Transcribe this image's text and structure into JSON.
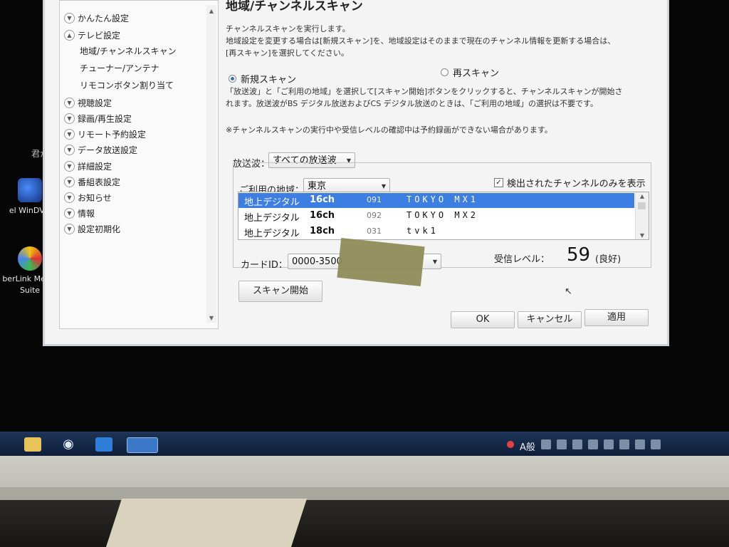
{
  "desktop": {
    "side_text": "君か",
    "icons": [
      {
        "label": "el WinDVD"
      },
      {
        "label": "berLink Media Suite"
      }
    ]
  },
  "sidebar": {
    "items": [
      {
        "label": "かんたん設定"
      },
      {
        "label": "テレビ設定"
      },
      {
        "label": "地域/チャンネルスキャン"
      },
      {
        "label": "チューナー/アンテナ"
      },
      {
        "label": "リモコンボタン割り当て"
      },
      {
        "label": "視聴設定"
      },
      {
        "label": "録画/再生設定"
      },
      {
        "label": "リモート予約設定"
      },
      {
        "label": "データ放送設定"
      },
      {
        "label": "詳細設定"
      },
      {
        "label": "番組表設定"
      },
      {
        "label": "お知らせ"
      },
      {
        "label": "情報"
      },
      {
        "label": "設定初期化"
      }
    ]
  },
  "main": {
    "title": "地域/チャンネルスキャン",
    "desc1": [
      "チャンネルスキャンを実行します。",
      "地域設定を変更する場合は[新規スキャン]を、地域設定はそのままで現在のチャンネル情報を更新する場合は、",
      "[再スキャン]を選択してください。"
    ],
    "radio_new": "新規スキャン",
    "radio_rescan": "再スキャン",
    "desc2": [
      "「放送波」と「ご利用の地域」を選択して[スキャン開始]ボタンをクリックすると、チャンネルスキャンが開始さ",
      "れます。放送波がBS デジタル放送およびCS デジタル放送のときは、「ご利用の地域」の選択は不要です。"
    ],
    "note": "※チャンネルスキャンの実行中や受信レベルの確認中は予約録画ができない場合があります。",
    "broadcast_label": "放送波：",
    "broadcast_value": "すべての放送波",
    "region_label": "ご利用の地域：",
    "region_value": "東京",
    "show_detected_label": "検出されたチャンネルのみを表示",
    "channels": [
      {
        "type": "地上デジタル",
        "ch": "16ch",
        "num": "091",
        "name": "TOKYO MX1"
      },
      {
        "type": "地上デジタル",
        "ch": "16ch",
        "num": "092",
        "name": "TOKYO MX2"
      },
      {
        "type": "地上デジタル",
        "ch": "18ch",
        "num": "031",
        "name": "tvk1"
      }
    ],
    "card_label": "カードID：",
    "card_value": "0000-3500",
    "level_label": "受信レベル：",
    "level_value": "59",
    "level_status": "(良好)",
    "scan_button": "スキャン開始",
    "ok_button": "OK",
    "cancel_button": "キャンセル",
    "apply_button": "適用"
  },
  "taskbar": {
    "ime_label": "A般"
  }
}
